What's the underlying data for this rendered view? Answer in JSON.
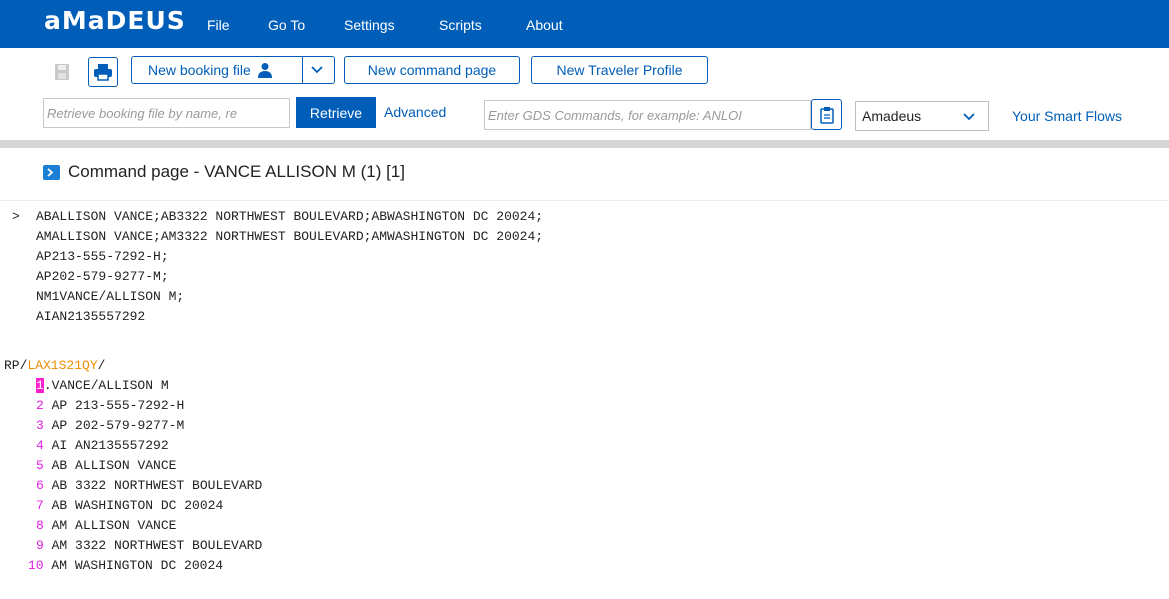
{
  "app": {
    "logo": "aMaDEUS",
    "menu": [
      "File",
      "Go To",
      "Settings",
      "Scripts",
      "About"
    ]
  },
  "toolbar": {
    "new_booking_label": "New booking file",
    "new_command_label": "New command page",
    "new_traveler_label": "New Traveler Profile",
    "retrieve_placeholder": "Retrieve booking file by name, re",
    "retrieve_label": "Retrieve",
    "advanced_label": "Advanced",
    "gds_placeholder": "Enter GDS Commands, for example: ANLOI",
    "provider_value": "Amadeus",
    "smart_flows_label": "Your Smart Flows"
  },
  "page": {
    "title": "Command page - VANCE ALLISON M (1) [1]"
  },
  "console": {
    "prompt": ">",
    "commands": [
      "ABALLISON VANCE;AB3322 NORTHWEST BOULEVARD;ABWASHINGTON DC 20024;",
      "AMALLISON VANCE;AM3322 NORTHWEST BOULEVARD;AMWASHINGTON DC 20024;",
      "AP213-555-7292-H;",
      "AP202-579-9277-M;",
      "NM1VANCE/ALLISON M;",
      "AIAN2135557292"
    ],
    "rp_prefix": "RP/",
    "rp_office": "LAX1S21QY",
    "rp_suffix": "/",
    "entries": [
      {
        "num": "1",
        "text": ".VANCE/ALLISON M"
      },
      {
        "num": "2",
        "text": "AP 213-555-7292-H"
      },
      {
        "num": "3",
        "text": "AP 202-579-9277-M"
      },
      {
        "num": "4",
        "text": "AI AN2135557292"
      },
      {
        "num": "5",
        "text": "AB ALLISON VANCE"
      },
      {
        "num": "6",
        "text": "AB 3322 NORTHWEST BOULEVARD"
      },
      {
        "num": "7",
        "text": "AB WASHINGTON DC 20024"
      },
      {
        "num": "8",
        "text": "AM ALLISON VANCE"
      },
      {
        "num": "9",
        "text": "AM 3322 NORTHWEST BOULEVARD"
      },
      {
        "num": "10",
        "text": "AM WASHINGTON DC 20024"
      }
    ]
  },
  "colors": {
    "brand_blue": "#005eb8",
    "line_number_magenta": "#e020e0",
    "highlight_pink": "#ff1fd0",
    "office_orange": "#f08c00"
  },
  "icons": [
    "save-icon",
    "print-icon",
    "person-icon",
    "chevron-down-icon",
    "clipboard-icon",
    "command-page-icon"
  ]
}
